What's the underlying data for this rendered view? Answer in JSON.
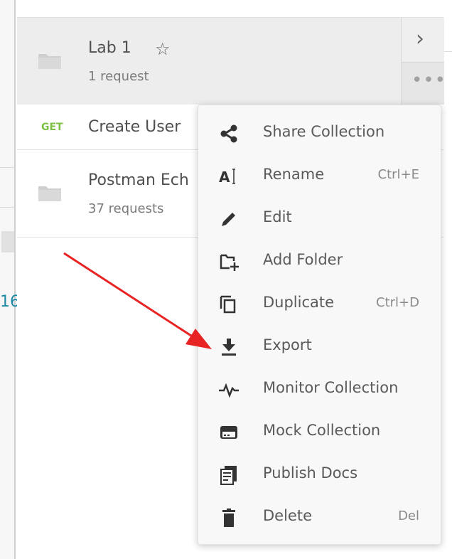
{
  "sidebar": {
    "collections": [
      {
        "name": "Lab 1",
        "count": "1 request",
        "requests": [
          {
            "method": "GET",
            "name": "Create User"
          }
        ]
      },
      {
        "name": "Postman Ech",
        "count": "37 requests"
      }
    ],
    "icons": {
      "star": "☆",
      "chevron": "›",
      "more": "•••"
    }
  },
  "context_menu": {
    "items": [
      {
        "icon": "share-icon",
        "label": "Share Collection",
        "shortcut": ""
      },
      {
        "icon": "rename-icon",
        "label": "Rename",
        "shortcut": "Ctrl+E"
      },
      {
        "icon": "edit-icon",
        "label": "Edit",
        "shortcut": ""
      },
      {
        "icon": "add-folder-icon",
        "label": "Add Folder",
        "shortcut": ""
      },
      {
        "icon": "duplicate-icon",
        "label": "Duplicate",
        "shortcut": "Ctrl+D"
      },
      {
        "icon": "export-icon",
        "label": "Export",
        "shortcut": ""
      },
      {
        "icon": "monitor-icon",
        "label": "Monitor Collection",
        "shortcut": ""
      },
      {
        "icon": "mock-icon",
        "label": "Mock Collection",
        "shortcut": ""
      },
      {
        "icon": "docs-icon",
        "label": "Publish Docs",
        "shortcut": ""
      },
      {
        "icon": "delete-icon",
        "label": "Delete",
        "shortcut": "Del"
      }
    ]
  },
  "left_edge": {
    "fragment": "16"
  },
  "colors": {
    "method_get": "#7bc043",
    "annotation_arrow": "#e82323",
    "selected_row": "#ededed",
    "menu_background": "#f8f8f8"
  }
}
